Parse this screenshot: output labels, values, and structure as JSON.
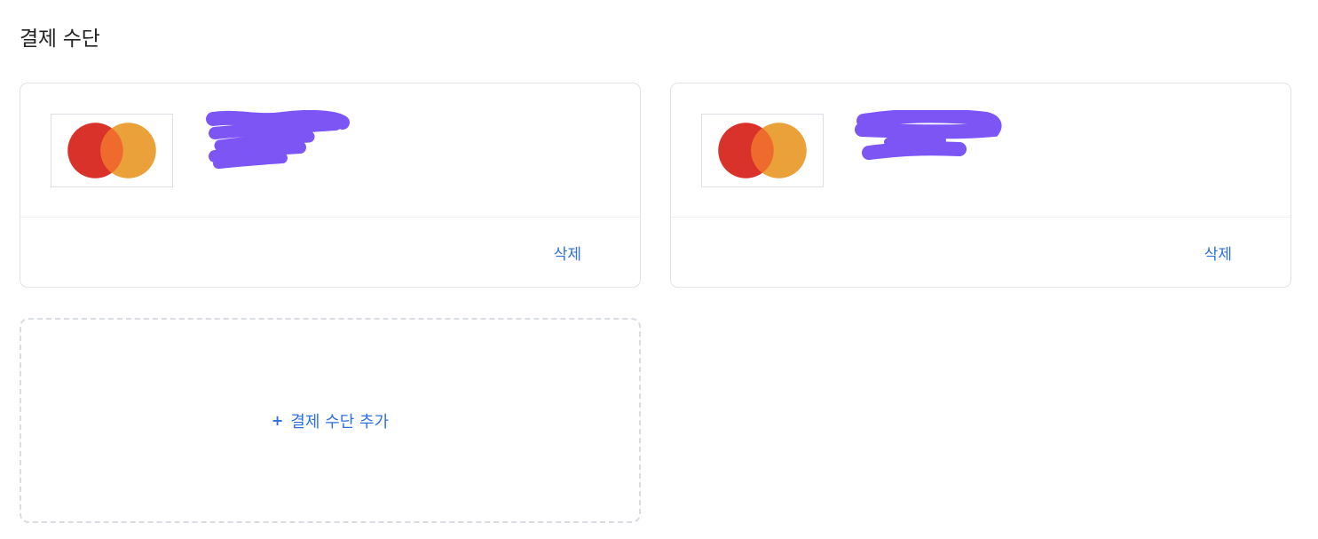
{
  "page": {
    "title": "결제 수단"
  },
  "payment_methods": [
    {
      "brand_icon": "mastercard-icon",
      "details_redacted": true,
      "delete_label": "삭제"
    },
    {
      "brand_icon": "mastercard-icon",
      "details_redacted": true,
      "delete_label": "삭제"
    }
  ],
  "add_payment": {
    "plus": "+",
    "label": "결제 수단 추가"
  },
  "colors": {
    "accent": "#2f6fdf",
    "mastercard_red": "#d9322a",
    "mastercard_orange": "#eba13a",
    "mastercard_overlap": "#ef6b2d",
    "redaction": "#7d55f5",
    "border": "#e1e3e6"
  }
}
